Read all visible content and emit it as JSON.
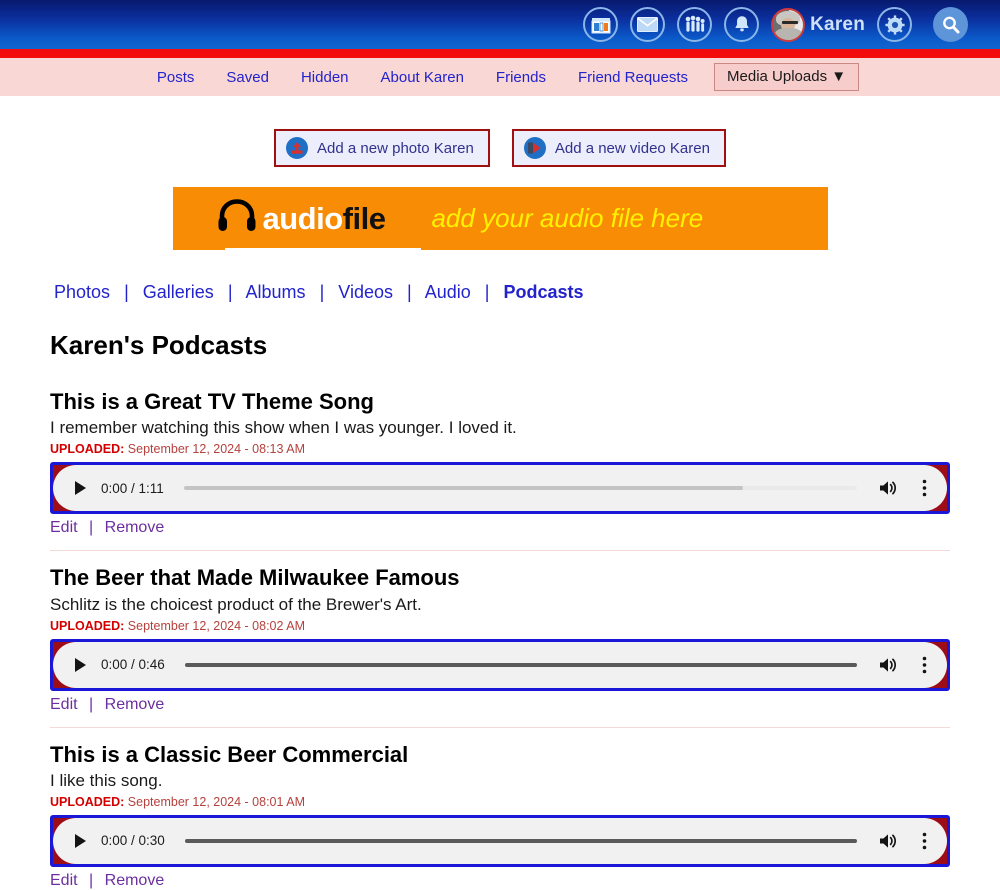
{
  "topbar": {
    "icons": [
      {
        "name": "marketplace-icon",
        "title": "Marketplace"
      },
      {
        "name": "messages-icon",
        "title": "Messages"
      },
      {
        "name": "friends-group-icon",
        "title": "Friends"
      },
      {
        "name": "notifications-bell-icon",
        "title": "Notifications"
      }
    ],
    "username": "Karen",
    "gear_title": "Settings",
    "search_title": "Search",
    "gradient_top": "#07196e",
    "gradient_bottom": "#1266cf",
    "stripe_color": "#f30c0c"
  },
  "nav": {
    "background": "#f9d7d4",
    "link_color": "#2323cc",
    "items": [
      {
        "label": "Posts"
      },
      {
        "label": "Saved"
      },
      {
        "label": "Hidden"
      },
      {
        "label": "About Karen"
      },
      {
        "label": "Friends"
      },
      {
        "label": "Friend Requests"
      }
    ],
    "dropdown_label": "Media Uploads ▼"
  },
  "actions": {
    "add_photo_label": "Add a new photo Karen",
    "add_video_label": "Add a new video Karen"
  },
  "banner": {
    "brand_part1": "audio",
    "brand_part2": "file",
    "tagline": "add your audio file here",
    "background": "#f98c05",
    "tagline_color": "#fff200"
  },
  "subtabs": {
    "items": [
      {
        "label": "Photos",
        "active": false
      },
      {
        "label": "Galleries",
        "active": false
      },
      {
        "label": "Albums",
        "active": false
      },
      {
        "label": "Videos",
        "active": false
      },
      {
        "label": "Audio",
        "active": false
      },
      {
        "label": "Podcasts",
        "active": true
      }
    ],
    "separator": "|"
  },
  "page": {
    "title": "Karen's Podcasts"
  },
  "podcasts": [
    {
      "title": "This is a Great TV Theme Song",
      "description": "I remember watching this show when I was younger. I loved it.",
      "uploaded_label": "UPLOADED:",
      "uploaded_value": "September 12, 2024 - 08:13 AM",
      "player": {
        "time": "0:00 / 1:11",
        "current": "0:00",
        "duration": "1:11",
        "progress_percent": 0,
        "buffer_percent": 83
      },
      "edit_label": "Edit",
      "remove_label": "Remove",
      "separator": "|"
    },
    {
      "title": "The Beer that Made Milwaukee Famous",
      "description": "Schlitz is the choicest product of the Brewer's Art.",
      "uploaded_label": "UPLOADED:",
      "uploaded_value": "September 12, 2024 - 08:02 AM",
      "player": {
        "time": "0:00 / 0:46",
        "current": "0:00",
        "duration": "0:46",
        "progress_percent": 0,
        "buffer_percent": 100
      },
      "edit_label": "Edit",
      "remove_label": "Remove",
      "separator": "|"
    },
    {
      "title": "This is a Classic Beer Commercial",
      "description": "I like this song.",
      "uploaded_label": "UPLOADED:",
      "uploaded_value": "September 12, 2024 - 08:01 AM",
      "player": {
        "time": "0:00 / 0:30",
        "current": "0:00",
        "duration": "0:30",
        "progress_percent": 0,
        "buffer_percent": 100
      },
      "edit_label": "Edit",
      "remove_label": "Remove",
      "separator": "|"
    }
  ]
}
